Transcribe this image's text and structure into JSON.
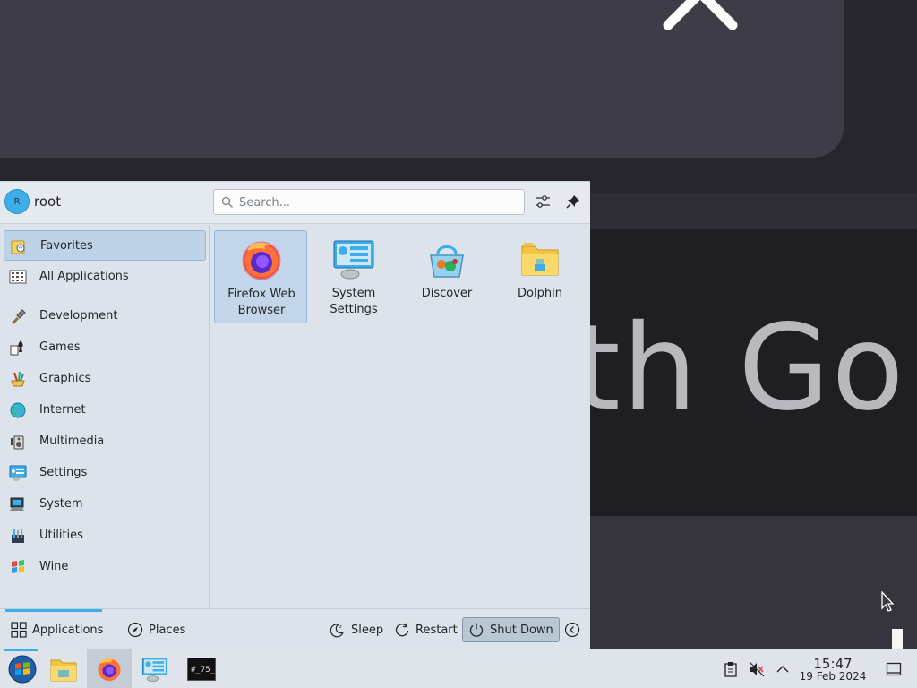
{
  "desktop": {
    "background_text": "th Go"
  },
  "launcher": {
    "user": {
      "name": "root",
      "avatar_initial": "R"
    },
    "search": {
      "placeholder": "Search...",
      "value": ""
    },
    "sidebar": {
      "items": [
        {
          "label": "Favorites",
          "icon": "favorites-icon",
          "active": true
        },
        {
          "label": "All Applications",
          "icon": "all-applications-icon",
          "active": false
        },
        {
          "label": "Development",
          "icon": "development-icon",
          "active": false
        },
        {
          "label": "Games",
          "icon": "games-icon",
          "active": false
        },
        {
          "label": "Graphics",
          "icon": "graphics-icon",
          "active": false
        },
        {
          "label": "Internet",
          "icon": "internet-icon",
          "active": false
        },
        {
          "label": "Multimedia",
          "icon": "multimedia-icon",
          "active": false
        },
        {
          "label": "Settings",
          "icon": "settings-icon",
          "active": false
        },
        {
          "label": "System",
          "icon": "system-icon",
          "active": false
        },
        {
          "label": "Utilities",
          "icon": "utilities-icon",
          "active": false
        },
        {
          "label": "Wine",
          "icon": "wine-icon",
          "active": false
        }
      ]
    },
    "favorites": [
      {
        "label": "Firefox Web Browser",
        "icon": "firefox-icon",
        "active": true
      },
      {
        "label": "System Settings",
        "icon": "system-settings-icon",
        "active": false
      },
      {
        "label": "Discover",
        "icon": "discover-icon",
        "active": false
      },
      {
        "label": "Dolphin",
        "icon": "dolphin-folder-icon",
        "active": false
      }
    ],
    "footer": {
      "tabs": [
        {
          "label": "Applications",
          "icon": "grid-icon",
          "active": true
        },
        {
          "label": "Places",
          "icon": "compass-icon",
          "active": false
        }
      ],
      "actions": [
        {
          "label": "Sleep",
          "icon": "sleep-icon"
        },
        {
          "label": "Restart",
          "icon": "restart-icon"
        },
        {
          "label": "Shut Down",
          "icon": "power-icon",
          "pressed": true
        }
      ]
    }
  },
  "taskbar": {
    "items": [
      {
        "name": "application-launcher",
        "icon": "start-orb-icon",
        "active": false
      },
      {
        "name": "file-manager",
        "icon": "folder-icon",
        "active": false
      },
      {
        "name": "firefox",
        "icon": "firefox-icon",
        "active": true
      },
      {
        "name": "system-settings",
        "icon": "system-settings-icon",
        "active": false
      },
      {
        "name": "terminal",
        "icon": "terminal-icon",
        "active": false
      }
    ],
    "tray": [
      "clipboard-icon",
      "volume-muted-icon",
      "chevron-up-icon"
    ],
    "clock": {
      "time": "15:47",
      "date": "19 Feb 2024"
    },
    "show_desktop_icon": "show-desktop-icon"
  },
  "colors": {
    "accent": "#3daee9",
    "panel_bg": "#dce3ea",
    "selection": "#bed3e8"
  }
}
